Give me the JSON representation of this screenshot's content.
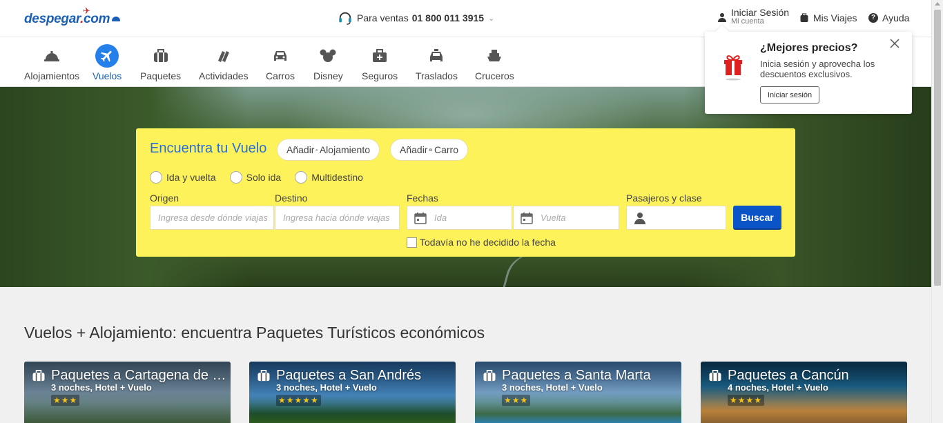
{
  "header": {
    "logo_text": "despegar",
    "logo_dot": ".",
    "logo_com": "com",
    "sales_label": "Para ventas",
    "sales_phone": "01 800 011 3915",
    "login_label": "Iniciar Sesión",
    "login_sub": "Mi cuenta",
    "trips_label": "Mis Viajes",
    "help_label": "Ayuda"
  },
  "nav": {
    "items": [
      {
        "label": "Alojamientos",
        "icon": "hotel-bell-icon"
      },
      {
        "label": "Vuelos",
        "icon": "plane-icon",
        "active": true
      },
      {
        "label": "Paquetes",
        "icon": "suitcase-icon"
      },
      {
        "label": "Actividades",
        "icon": "tickets-icon"
      },
      {
        "label": "Carros",
        "icon": "car-icon"
      },
      {
        "label": "Disney",
        "icon": "mickey-icon"
      },
      {
        "label": "Seguros",
        "icon": "medical-case-icon"
      },
      {
        "label": "Traslados",
        "icon": "taxi-icon"
      },
      {
        "label": "Cruceros",
        "icon": "ship-icon"
      }
    ]
  },
  "search": {
    "title": "Encuentra tu Vuelo",
    "add_lodging_prefix": "Añadir",
    "add_lodging_label": "Alojamiento",
    "add_car_prefix": "Añadir",
    "add_car_label": "Carro",
    "trip_types": [
      "Ida y vuelta",
      "Solo ida",
      "Multidestino"
    ],
    "origin_label": "Origen",
    "origin_placeholder": "Ingresa desde dónde viajas",
    "destination_label": "Destino",
    "destination_placeholder": "Ingresa hacia dónde viajas",
    "dates_label": "Fechas",
    "depart_placeholder": "Ida",
    "return_placeholder": "Vuelta",
    "passengers_label": "Pasajeros y clase",
    "search_button": "Buscar",
    "undecided_label": "Todavía no he decidido la fecha"
  },
  "popover": {
    "title": "¿Mejores precios?",
    "text": "Inicia sesión y aprovecha los descuentos exclusivos.",
    "button": "Iniciar sesión"
  },
  "packages": {
    "section_title": "Vuelos + Alojamiento: encuentra Paquetes Turísticos económicos",
    "cards": [
      {
        "title": "Paquetes a Cartagena de Indias",
        "subtitle": "3 noches, Hotel + Vuelo",
        "stars": "★★★"
      },
      {
        "title": "Paquetes a San Andrés",
        "subtitle": "3 noches, Hotel + Vuelo",
        "stars": "★★★★★"
      },
      {
        "title": "Paquetes a Santa Marta",
        "subtitle": "3 noches, Hotel + Vuelo",
        "stars": "★★★"
      },
      {
        "title": "Paquetes a Cancún",
        "subtitle": "4 noches, Hotel + Vuelo",
        "stars": "★★★★"
      }
    ]
  },
  "colors": {
    "brand_blue": "#1a5fb4",
    "search_yellow": "#fef25a",
    "button_blue": "#0b54c8",
    "gift_red": "#e02020"
  }
}
